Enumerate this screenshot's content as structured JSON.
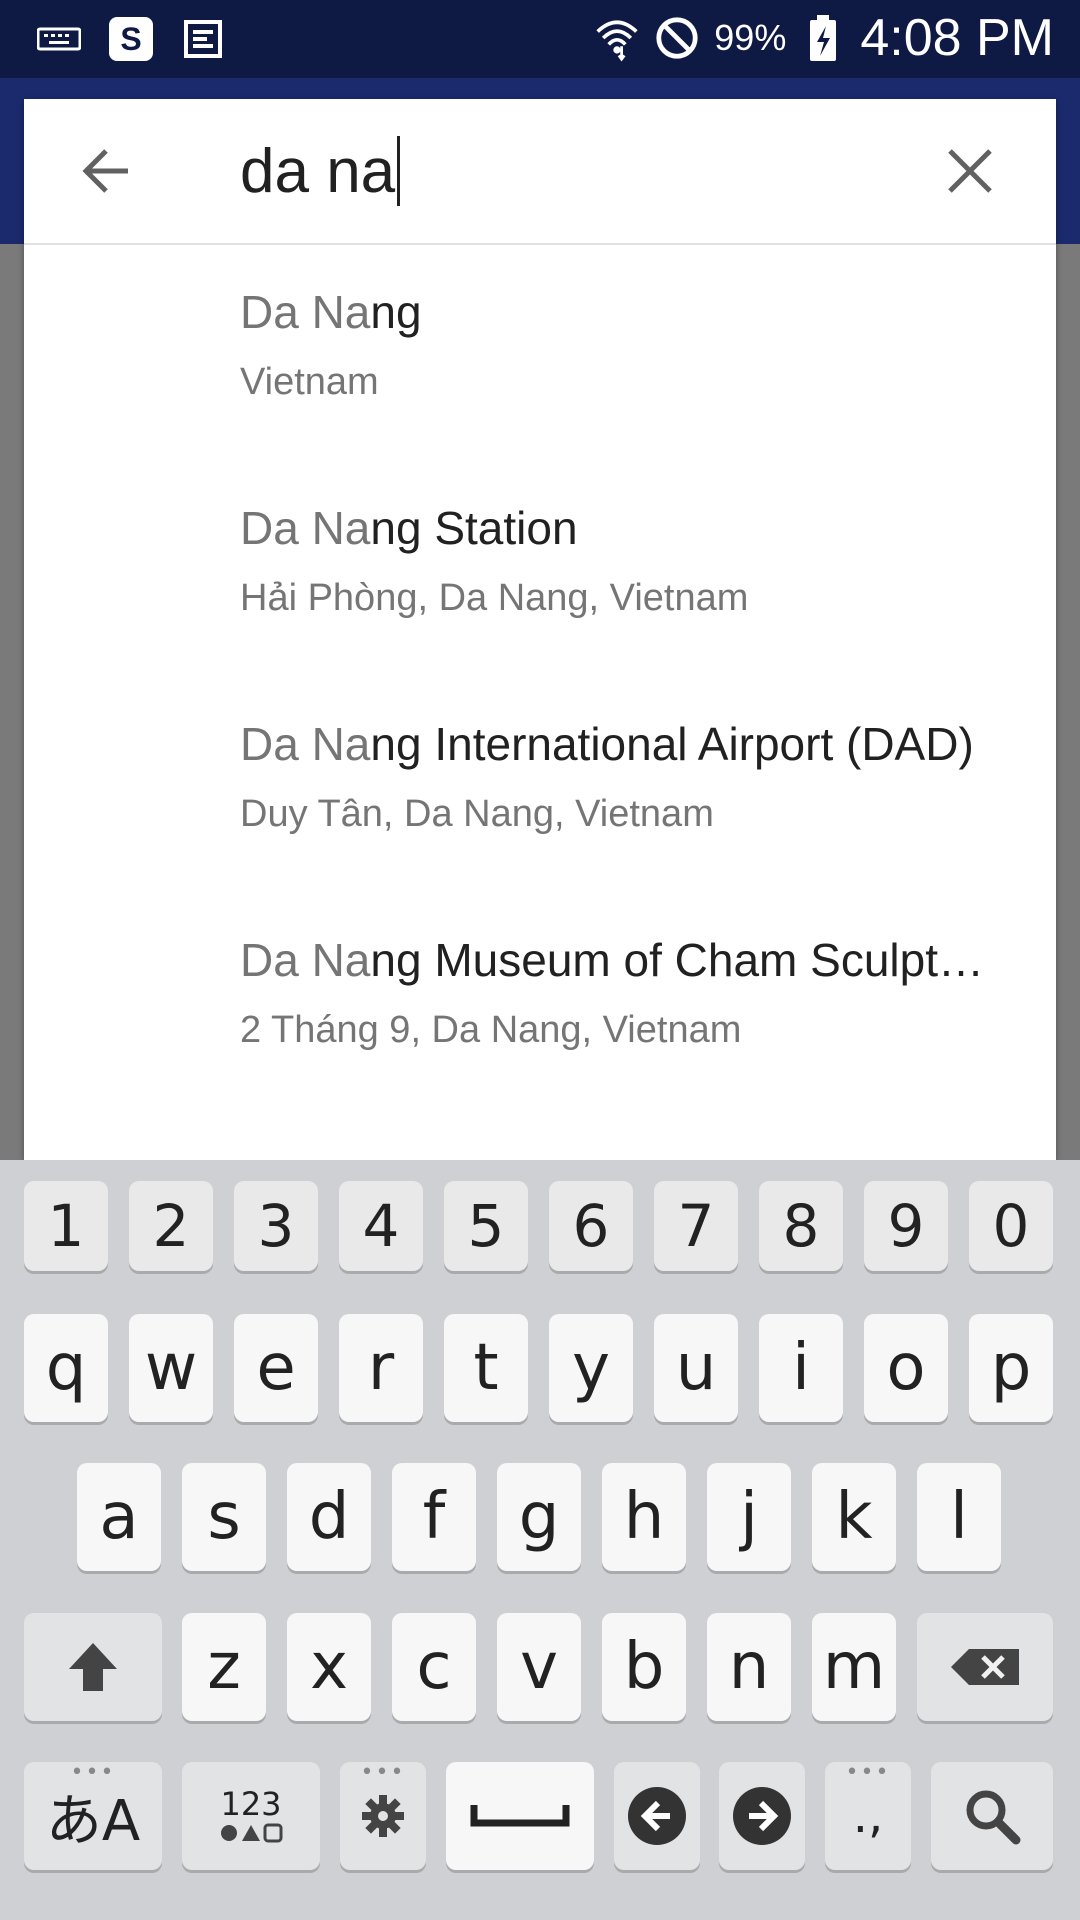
{
  "status_bar": {
    "battery_pct": "99%",
    "time": "4:08 PM",
    "icons": [
      "keyboard-icon",
      "s-app-icon",
      "calendar-app-icon",
      "wifi-icon",
      "do-not-disturb-icon",
      "battery-charging-icon"
    ]
  },
  "search": {
    "query": "da na"
  },
  "results": [
    {
      "title_match": "Da Na",
      "title_rest": "ng",
      "subtitle": "Vietnam"
    },
    {
      "title_match": "Da Na",
      "title_rest": "ng Station",
      "subtitle": "Hải Phòng, Da Nang, Vietnam"
    },
    {
      "title_match": "Da Na",
      "title_rest": "ng International Airport (DAD)",
      "subtitle": "Duy Tân, Da Nang, Vietnam"
    },
    {
      "title_match": "Da Na",
      "title_rest": "ng Museum of Cham Sculpt…",
      "subtitle": "2 Tháng 9, Da Nang, Vietnam"
    }
  ],
  "keyboard": {
    "numbers": [
      "1",
      "2",
      "3",
      "4",
      "5",
      "6",
      "7",
      "8",
      "9",
      "0"
    ],
    "row1": [
      "q",
      "w",
      "e",
      "r",
      "t",
      "y",
      "u",
      "i",
      "o",
      "p"
    ],
    "row2": [
      "a",
      "s",
      "d",
      "f",
      "g",
      "h",
      "j",
      "k",
      "l"
    ],
    "row3": [
      "z",
      "x",
      "c",
      "v",
      "b",
      "n",
      "m"
    ],
    "lang_key": "あA",
    "symbols_key_top": "123",
    "punct_key": ".,",
    "colors": {
      "background": "#cfd0d4",
      "key": "#f7f7f7"
    }
  }
}
